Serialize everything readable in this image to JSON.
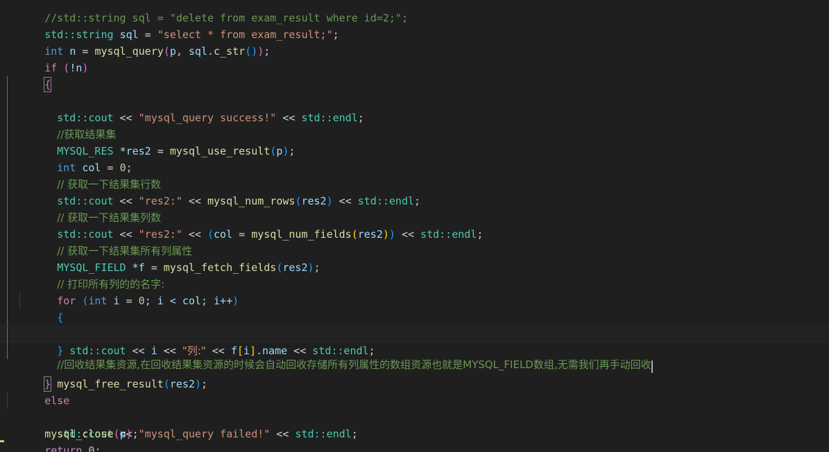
{
  "editor": {
    "language": "cpp",
    "background_color": "#1f1f1f",
    "foreground_color": "#cccccc",
    "current_line_number": 20,
    "caret_visible": true,
    "colors": {
      "comment": "#6a9955",
      "string": "#ce9178",
      "keyword": "#c586c0",
      "type": "#569cd6",
      "class": "#4ec9b0",
      "function": "#dcdcaa",
      "variable": "#9cdcfe",
      "number": "#b5cea8",
      "bracket_yellow": "#ffd700",
      "bracket_magenta": "#da70d6",
      "bracket_blue": "#179fff",
      "indent_guide": "#404040",
      "indent_guide_active": "#707070",
      "caret": "#aeafad",
      "current_line_border": "#2a2a2a",
      "dirty_marker": "#e2c08d"
    }
  },
  "code": {
    "line_01_comment_clipped": "//std::string sql = \"delete from exam_result where id=2;\";",
    "line_02": {
      "type_std_string": "std::string",
      "var_sql": "sql",
      "assign": " = ",
      "string_select": "\"select * from exam_result;\"",
      "semicolon": ";"
    },
    "line_03": {
      "kw_int": "int",
      "var_n": "n",
      "assign": " = ",
      "func_mysql_query": "mysql_query",
      "arg_p": "p",
      "comma": ", ",
      "var_sql": "sql",
      "dot": ".",
      "func_c_str": "c_str",
      "semicolon": ";"
    },
    "line_04": {
      "kw_if": "if",
      "not_n": "!n"
    },
    "line_05_open_brace": "{",
    "line_06": {
      "std_cout": "std::cout",
      "shift": " << ",
      "string_success": "\"mysql_query success!\"",
      "std_endl": "std::endl",
      "semicolon": ";"
    },
    "line_07_comment": "//获取结果集",
    "line_08": {
      "type_mysql_res": "MYSQL_RES",
      "star_res2": "*res2",
      "assign": " = ",
      "func_mysql_use_result": "mysql_use_result",
      "arg_p": "p",
      "semicolon": ";"
    },
    "line_09": {
      "kw_int": "int",
      "var_col": "col",
      "assign": " = ",
      "num_zero": "0",
      "semicolon": ";"
    },
    "line_10_comment": "// 获取一下结果集行数",
    "line_11": {
      "std_cout": "std::cout",
      "string_res2": "\"res2:\"",
      "func_mysql_num_rows": "mysql_num_rows",
      "arg_res2": "res2",
      "std_endl": "std::endl",
      "semicolon": ";"
    },
    "line_12_comment": "// 获取一下结果集列数",
    "line_13": {
      "std_cout": "std::cout",
      "string_res2": "\"res2:\"",
      "var_col": "col",
      "assign": " = ",
      "func_mysql_num_fields": "mysql_num_fields",
      "arg_res2": "res2",
      "std_endl": "std::endl",
      "semicolon": ";"
    },
    "line_14_comment": "// 获取一下结果集所有列属性",
    "line_15": {
      "type_mysql_field": "MYSQL_FIELD",
      "star_f": "*f",
      "assign": " = ",
      "func_mysql_fetch_fields": "mysql_fetch_fields",
      "arg_res2": "res2",
      "semicolon": ";"
    },
    "line_16_comment": "// 打印所有列的的名字:",
    "line_17": {
      "kw_for": "for",
      "kw_int": "int",
      "var_i": "i",
      "assign": " = ",
      "num_zero": "0",
      "semi1": "; ",
      "cond": "i < col",
      "semi2": "; ",
      "incr": "i++"
    },
    "line_18_open_brace": "{",
    "line_19": {
      "std_cout": "std::cout",
      "var_i": "i",
      "string_lie": "\"列:\"",
      "var_f": "f",
      "index_i": "i",
      "dot_name": ".name",
      "std_endl": "std::endl",
      "semicolon": ";"
    },
    "line_20_close_brace": "}",
    "line_21_comment_current": "//回收结果集资源,在回收结果集资源的时候会自动回收存储所有列属性的数组资源也就是MYSQL_FIELD数组,无需我们再手动回收",
    "line_22": {
      "func_mysql_free_result": "mysql_free_result",
      "arg_res2": "res2",
      "semicolon": ";"
    },
    "line_23_close_brace": "}",
    "line_24_else": "else",
    "line_25": {
      "std_cout": "std::cout",
      "string_failed": "\"mysql_query failed!\"",
      "std_endl": "std::endl",
      "semicolon": ";"
    },
    "line_26": {
      "func_mysql_close": "mysql_close",
      "arg_p": "p",
      "semicolon": ";"
    },
    "line_27": {
      "kw_return": "return",
      "num_zero": "0",
      "semicolon": ";"
    }
  },
  "symbols": {
    "shift_op": " << ",
    "paren_open": "(",
    "paren_close": ")",
    "bracket_open": "[",
    "bracket_close": "]",
    "semicolon": ";",
    "space": " "
  }
}
